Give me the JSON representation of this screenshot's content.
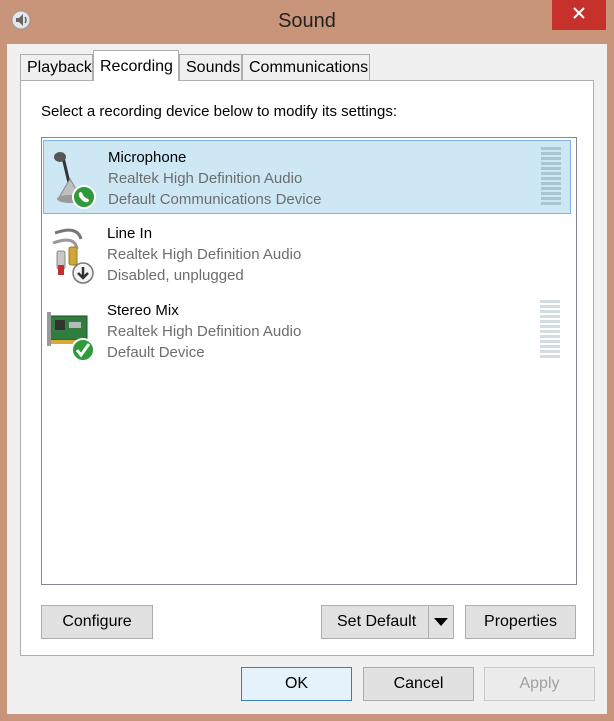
{
  "window": {
    "title": "Sound"
  },
  "tabs": [
    {
      "label": "Playback"
    },
    {
      "label": "Recording"
    },
    {
      "label": "Sounds"
    },
    {
      "label": "Communications"
    }
  ],
  "recording": {
    "instruction": "Select a recording device below to modify its settings:",
    "devices": [
      {
        "name": "Microphone",
        "driver": "Realtek High Definition Audio",
        "status": "Default Communications Device",
        "icon": "microphone-icon",
        "badge": "phone-badge-icon",
        "selected": true
      },
      {
        "name": "Line In",
        "driver": "Realtek High Definition Audio",
        "status": "Disabled, unplugged",
        "icon": "line-in-jack-icon",
        "badge": "down-arrow-badge-icon",
        "selected": false
      },
      {
        "name": "Stereo Mix",
        "driver": "Realtek High Definition Audio",
        "status": "Default Device",
        "icon": "sound-card-icon",
        "badge": "checkmark-badge-icon",
        "selected": false
      }
    ],
    "buttons": {
      "configure": "Configure",
      "set_default": "Set Default",
      "properties": "Properties"
    }
  },
  "dialog_buttons": {
    "ok": "OK",
    "cancel": "Cancel",
    "apply": "Apply"
  },
  "colors": {
    "selection": "#cde8f4",
    "selection_border": "#7eb4ea",
    "close": "#c7312b",
    "frame": "#c8957a"
  }
}
